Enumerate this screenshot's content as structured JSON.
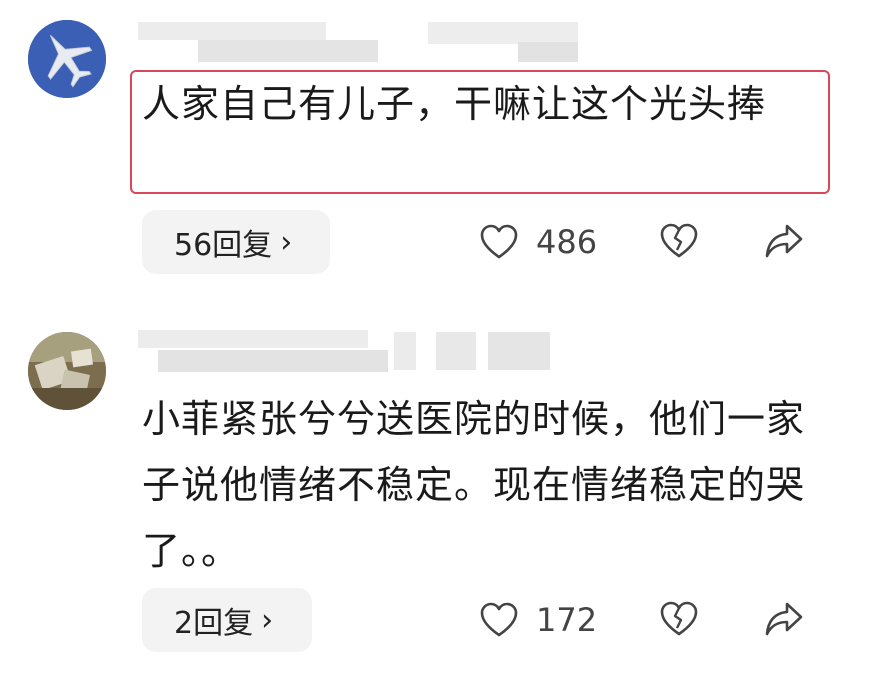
{
  "comments": [
    {
      "text": "人家自己有儿子，干嘛让这个光头捧",
      "reply_label": "56回复",
      "likes": "486",
      "highlighted": true
    },
    {
      "text": "小菲紧张兮兮送医院的时候，他们一家子说他情绪不稳定。现在情绪稳定的哭了。。",
      "reply_label": "2回复",
      "likes": "172",
      "highlighted": false
    }
  ],
  "icons": {
    "reply_chevron": "chevron-right-icon",
    "like": "heart-outline-icon",
    "dislike": "broken-heart-icon",
    "share": "share-arrow-icon"
  },
  "colors": {
    "highlight_border": "#d9475a",
    "reply_bg": "#f3f3f3",
    "icon_stroke": "#444444"
  }
}
